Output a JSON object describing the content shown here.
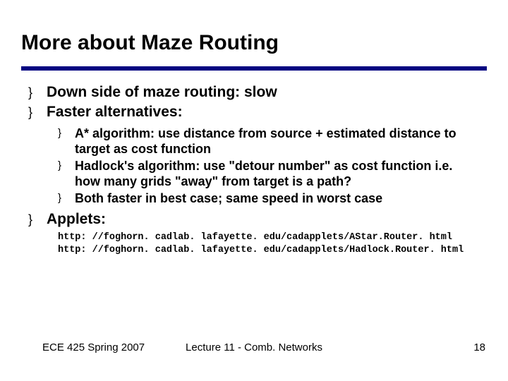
{
  "title": "More about Maze Routing",
  "bullets": {
    "b1a": "Down side of maze routing: slow",
    "b1b": "Faster alternatives:",
    "b2a": "A* algorithm: use distance from source + estimated distance to target as cost function",
    "b2b": "Hadlock's algorithm: use \"detour number\" as cost function i.e. how many grids \"away\" from target is a path?",
    "b2c": "Both faster in best case; same speed in worst case",
    "b1c": "Applets:"
  },
  "urls": {
    "u1": "http: //foghorn. cadlab. lafayette. edu/cadapplets/AStar.Router. html",
    "u2": "http: //foghorn. cadlab. lafayette. edu/cadapplets/Hadlock.Router. html"
  },
  "footer": {
    "left": "ECE 425 Spring 2007",
    "center": "Lecture 11 - Comb. Networks",
    "right": "18"
  },
  "glyphs": {
    "bullet": "}"
  }
}
